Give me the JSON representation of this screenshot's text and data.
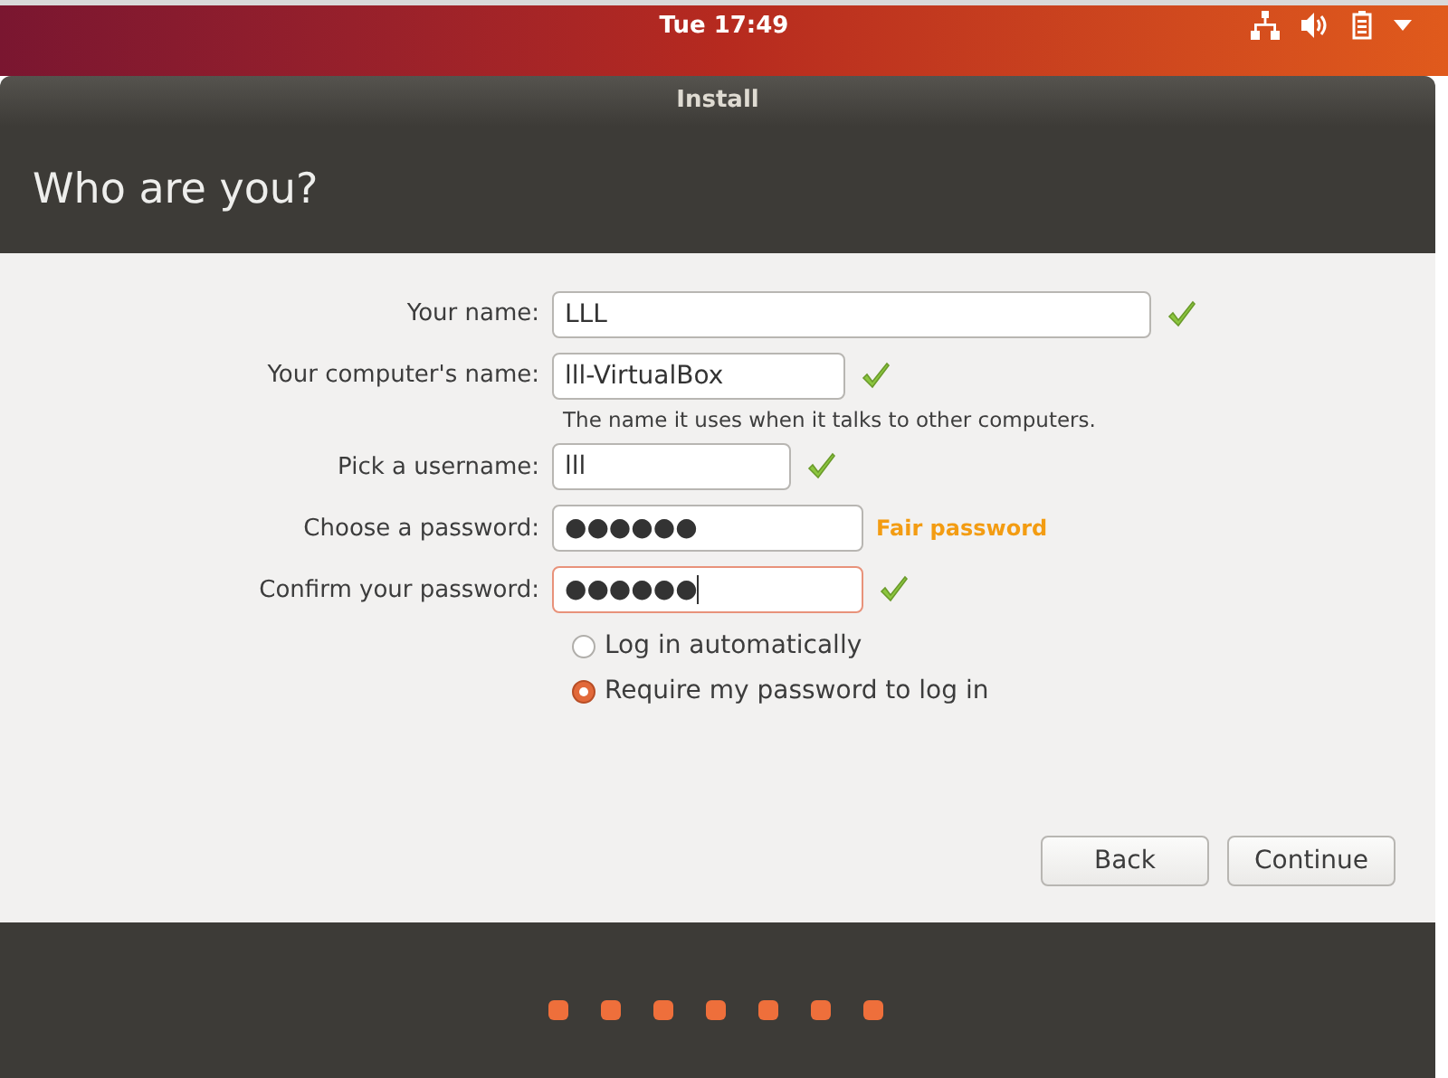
{
  "top_bar": {
    "clock": "Tue 17:49"
  },
  "window": {
    "title": "Install"
  },
  "header": {
    "title": "Who are you?"
  },
  "fields": [
    {
      "label": "Your name:",
      "value": "LLL",
      "valid": true,
      "focused": false
    },
    {
      "label": "Your computer's name:",
      "value": "lll-VirtualBox",
      "valid": true,
      "focused": false,
      "hint": "The name it uses when it talks to other computers."
    },
    {
      "label": "Pick a username:",
      "value": "lll",
      "valid": true,
      "focused": false
    },
    {
      "label": "Choose a password:",
      "value": "●●●●●●",
      "valid": false,
      "focused": false,
      "strength": "Fair password"
    },
    {
      "label": "Confirm your password:",
      "value": "●●●●●●",
      "valid": true,
      "focused": true
    }
  ],
  "login_options": [
    {
      "label": "Log in automatically",
      "selected": false
    },
    {
      "label": "Require my password to log in",
      "selected": true
    }
  ],
  "buttons": [
    "Back",
    "Continue"
  ]
}
